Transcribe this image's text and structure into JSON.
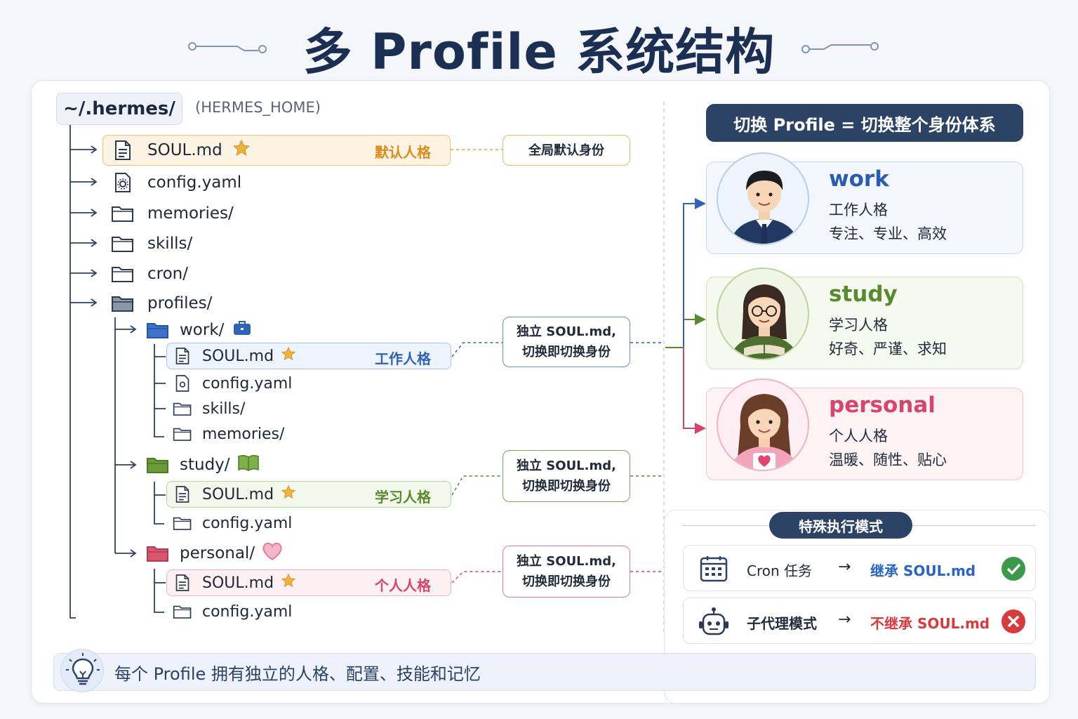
{
  "title": "多 Profile 系统结构",
  "root": {
    "path": "~/.hermes/",
    "label": "(HERMES_HOME)"
  },
  "tree": {
    "soul": {
      "name": "SOUL.md",
      "tag": "默认人格"
    },
    "config": "config.yaml",
    "memories": "memories/",
    "skills": "skills/",
    "cron": "cron/",
    "profiles": "profiles/"
  },
  "callouts": {
    "global": "全局默认身份",
    "independent_line1": "独立 SOUL.md,",
    "independent_line2": "切换即切换身份"
  },
  "profiles": [
    {
      "folder": "work/",
      "soul": "SOUL.md",
      "tag": "工作人格",
      "files": [
        "config.yaml",
        "skills/",
        "memories/"
      ],
      "color": "#2f62b8"
    },
    {
      "folder": "study/",
      "soul": "SOUL.md",
      "tag": "学习人格",
      "files": [
        "config.yaml"
      ],
      "color": "#5a8a2e"
    },
    {
      "folder": "personal/",
      "soul": "SOUL.md",
      "tag": "个人人格",
      "files": [
        "config.yaml"
      ],
      "color": "#d9446b"
    }
  ],
  "right_header": "切换 Profile = 切换整个身份体系",
  "cards": [
    {
      "name": "work",
      "role": "工作人格",
      "traits": "专注、专业、高效",
      "color": "#2a5cb3"
    },
    {
      "name": "study",
      "role": "学习人格",
      "traits": "好奇、严谨、求知",
      "color": "#5a8a2e"
    },
    {
      "name": "personal",
      "role": "个人人格",
      "traits": "温暖、随性、贴心",
      "color": "#d9446b"
    }
  ],
  "modes": {
    "title": "特殊执行模式",
    "rows": [
      {
        "name": "Cron 任务",
        "arrow": "→",
        "result": "继承 SOUL.md",
        "result_color": "#2a63c7",
        "status": "check"
      },
      {
        "name": "子代理模式",
        "arrow": "→",
        "result": "不继承 SOUL.md",
        "result_color": "#d83b3b",
        "status": "cross"
      }
    ]
  },
  "footer": "每个 Profile 拥有独立的人格、配置、技能和记忆",
  "colors": {
    "navy": "#2c4366",
    "orange": "#e8a33c",
    "blue": "#2f62b8",
    "green": "#5a8a2e",
    "pink": "#d9446b"
  }
}
